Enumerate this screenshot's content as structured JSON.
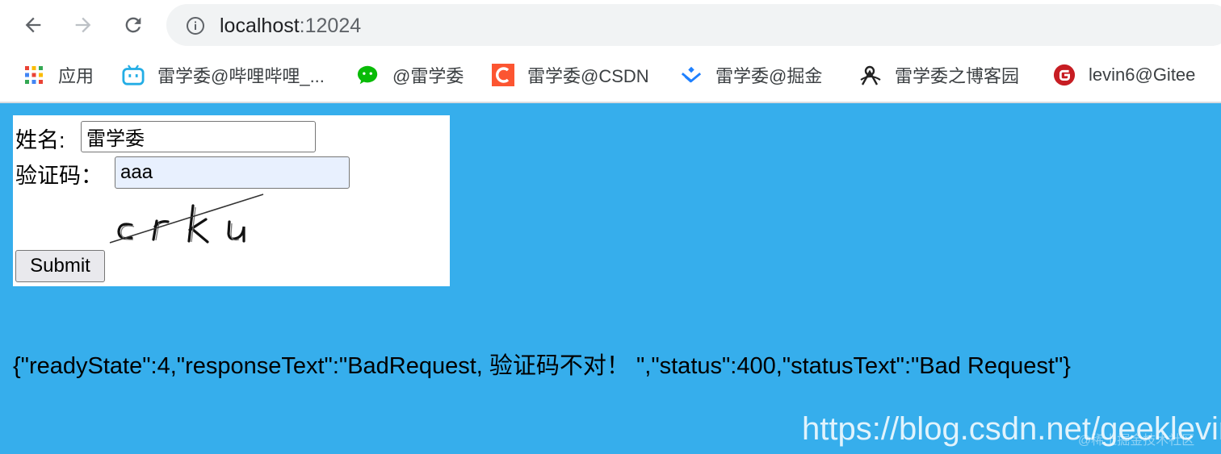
{
  "browser": {
    "url_host": "localhost",
    "url_port": ":12024",
    "bookmarks": [
      {
        "label": "应用",
        "icon": "apps-grid-icon"
      },
      {
        "label": "雷学委@哔哩哔哩_...",
        "icon": "bilibili-icon"
      },
      {
        "label": "@雷学委",
        "icon": "wechat-icon"
      },
      {
        "label": "雷学委@CSDN",
        "icon": "csdn-icon"
      },
      {
        "label": "雷学委@掘金",
        "icon": "juejin-icon"
      },
      {
        "label": "雷学委之博客园",
        "icon": "cnblogs-icon"
      },
      {
        "label": "levin6@Gitee",
        "icon": "gitee-icon"
      }
    ]
  },
  "form": {
    "name_label": "姓名:",
    "name_value": "雷学委",
    "captcha_label": "验证码：",
    "captcha_value": "aaa",
    "captcha_image_text": "crku",
    "submit_label": "Submit"
  },
  "response_text": "{\"readyState\":4,\"responseText\":\"BadRequest, 验证码不对！ \",\"status\":400,\"statusText\":\"Bad Request\"}",
  "watermark": "https://blog.csdn.net/geeklevin",
  "watermark_sub": "@稀土掘金技术社区",
  "colors": {
    "page_bg": "#36aeec",
    "form_bg": "#ffffff",
    "autofill_bg": "#e8f0fe"
  }
}
